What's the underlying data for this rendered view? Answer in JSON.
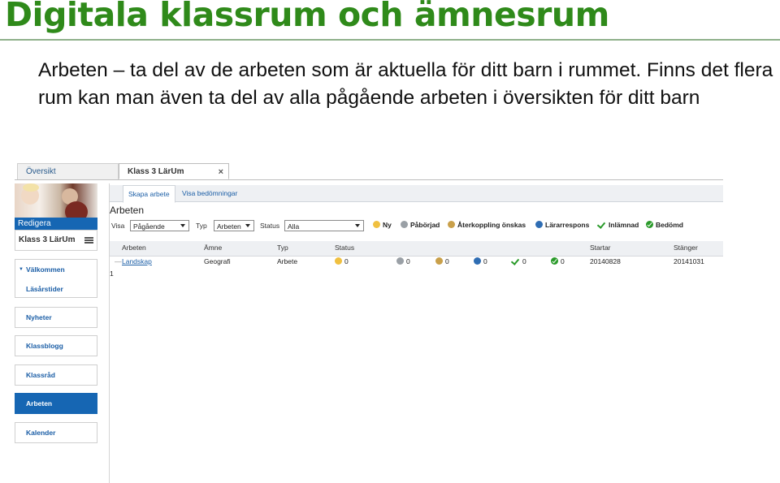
{
  "slide": {
    "title": "Digitala klassrum och ämnesrum",
    "bullet": "Arbeten – ta del av de arbeten som är aktuella för ditt barn i rummet. Finns det flera rum kan man även ta del av alla pågående arbeten i översikten för ditt barn"
  },
  "app": {
    "tabs": [
      {
        "label": "Översikt"
      },
      {
        "label": "Klass 3 LärUm",
        "close": "×"
      }
    ],
    "sidebar": {
      "edit_label": "Redigera",
      "room_name": "Klass 3 LärUm",
      "group": {
        "caret": "▼",
        "items": [
          "Välkommen",
          "Läsårstider"
        ]
      },
      "buttons": [
        "Nyheter",
        "Klassblogg",
        "Klassråd",
        "Arbeten",
        "Kalender"
      ],
      "active_button": "Arbeten"
    },
    "subtabs": [
      "Skapa arbete",
      "Visa bedömningar"
    ],
    "heading": "Arbeten",
    "filters": {
      "visa_label": "Visa",
      "visa_value": "Pågående",
      "typ_label": "Typ",
      "typ_value": "Arbeten",
      "status_label": "Status",
      "status_value": "Alla"
    },
    "legend": [
      "Ny",
      "Påbörjad",
      "Återkoppling önskas",
      "Lärarrespons",
      "Inlämnad",
      "Bedömd"
    ],
    "table": {
      "headers": [
        "Arbeten",
        "Ämne",
        "Typ",
        "Status",
        "Startar",
        "Stänger"
      ],
      "rows": [
        {
          "name": "Landskap",
          "subject": "Geografi",
          "type": "Arbete",
          "counts": [
            "0",
            "0",
            "0",
            "0",
            "0",
            "0"
          ],
          "start": "20140828",
          "end": "20141031"
        }
      ]
    },
    "pager": "1",
    "colors": {
      "title_green": "#2f8a1a",
      "nav_blue": "#1666b3",
      "link_blue": "#1b5ea6"
    }
  }
}
